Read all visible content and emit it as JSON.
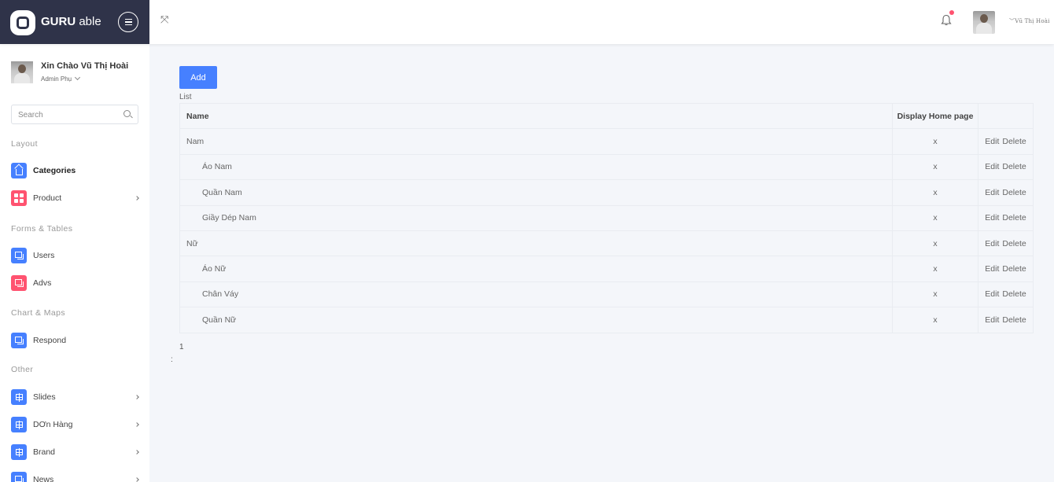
{
  "header": {
    "brand_bold": "GURU",
    "brand_light": " able",
    "user_name": "Vũ Thị Hoài",
    "notification_badge_color": "#ff5370"
  },
  "sidebar": {
    "greeting": "Xin Chào Vũ Thị Hoài",
    "role": "Admin Phụ",
    "search_placeholder": "Search",
    "sections": [
      {
        "label": "Layout"
      },
      {
        "label": "Forms & Tables"
      },
      {
        "label": "Chart & Maps"
      },
      {
        "label": "Other"
      }
    ],
    "items": [
      {
        "label": "Categories",
        "icon": "home-icon",
        "color": "#4680ff",
        "active": true,
        "has_submenu": false
      },
      {
        "label": "Product",
        "icon": "grid-icon",
        "color": "#ff5370",
        "active": false,
        "has_submenu": true
      },
      {
        "label": "Users",
        "icon": "copy-icon",
        "color": "#4680ff",
        "active": false,
        "has_submenu": false
      },
      {
        "label": "Advs",
        "icon": "copy-icon",
        "color": "#ff5370",
        "active": false,
        "has_submenu": false
      },
      {
        "label": "Respond",
        "icon": "copy-icon",
        "color": "#4680ff",
        "active": false,
        "has_submenu": false
      },
      {
        "label": "Slides",
        "icon": "signpost-icon",
        "color": "#4680ff",
        "active": false,
        "has_submenu": true
      },
      {
        "label": "DƠn Hàng",
        "icon": "signpost-icon",
        "color": "#4680ff",
        "active": false,
        "has_submenu": true
      },
      {
        "label": "Brand",
        "icon": "signpost-icon",
        "color": "#4680ff",
        "active": false,
        "has_submenu": true
      },
      {
        "label": "News",
        "icon": "copy-icon",
        "color": "#4680ff",
        "active": false,
        "has_submenu": true
      }
    ]
  },
  "main": {
    "add_label": "Add",
    "list_label": "List",
    "table": {
      "columns": [
        "Name",
        "Display Home page",
        ""
      ],
      "rows": [
        {
          "name": "Nam",
          "child": false,
          "display": "x",
          "edit": "Edit",
          "delete": "Delete"
        },
        {
          "name": "Áo Nam",
          "child": true,
          "display": "x",
          "edit": "Edit",
          "delete": "Delete"
        },
        {
          "name": "Quần Nam",
          "child": true,
          "display": "x",
          "edit": "Edit",
          "delete": "Delete"
        },
        {
          "name": "Giầy Dép Nam",
          "child": true,
          "display": "x",
          "edit": "Edit",
          "delete": "Delete"
        },
        {
          "name": "Nữ",
          "child": false,
          "display": "x",
          "edit": "Edit",
          "delete": "Delete"
        },
        {
          "name": "Áo Nữ",
          "child": true,
          "display": "x",
          "edit": "Edit",
          "delete": "Delete"
        },
        {
          "name": "Chân Váy",
          "child": true,
          "display": "x",
          "edit": "Edit",
          "delete": "Delete"
        },
        {
          "name": "Quần Nữ",
          "child": true,
          "display": "x",
          "edit": "Edit",
          "delete": "Delete"
        }
      ]
    },
    "pagination": "1",
    "trailing_text": ":"
  }
}
